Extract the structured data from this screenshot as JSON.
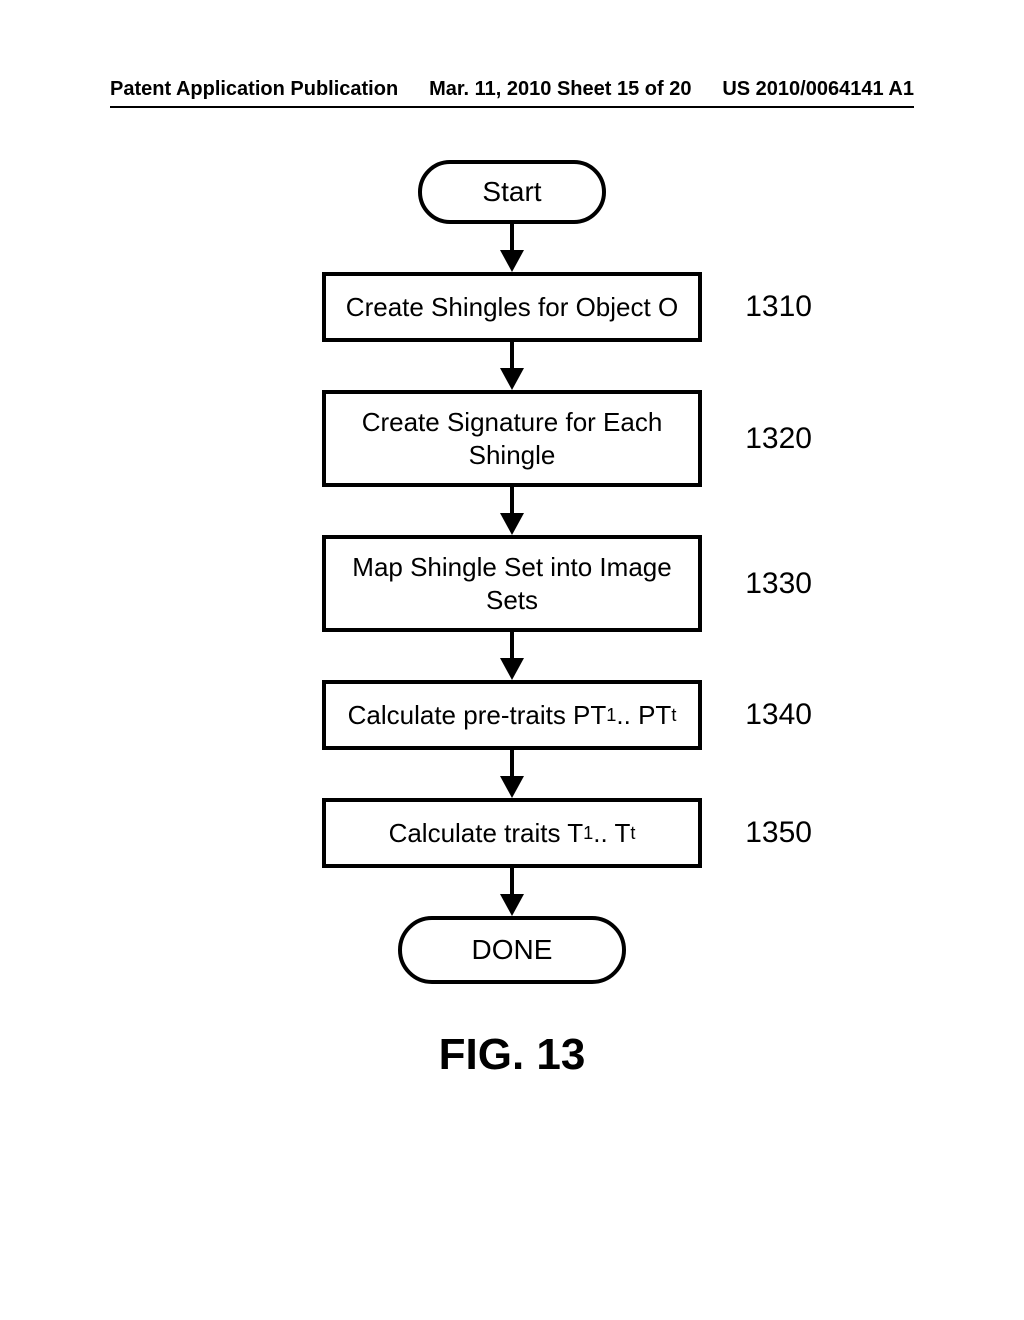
{
  "header": {
    "left": "Patent Application Publication",
    "center": "Mar. 11, 2010  Sheet 15 of 20",
    "right": "US 2010/0064141 A1"
  },
  "flow": {
    "start": "Start",
    "steps": [
      {
        "text": "Create Shingles for Object O",
        "ref": "1310"
      },
      {
        "text": "Create Signature for Each Shingle",
        "ref": "1320"
      },
      {
        "text": "Map Shingle Set into Image Sets",
        "ref": "1330"
      },
      {
        "text_html": "Calculate pre-traits PT<sub>1</sub> .. PT<sub>t</sub>",
        "ref": "1340"
      },
      {
        "text_html": "Calculate traits T<sub>1</sub> .. T<sub>t</sub>",
        "ref": "1350"
      }
    ],
    "end": "DONE"
  },
  "caption": "FIG. 13"
}
